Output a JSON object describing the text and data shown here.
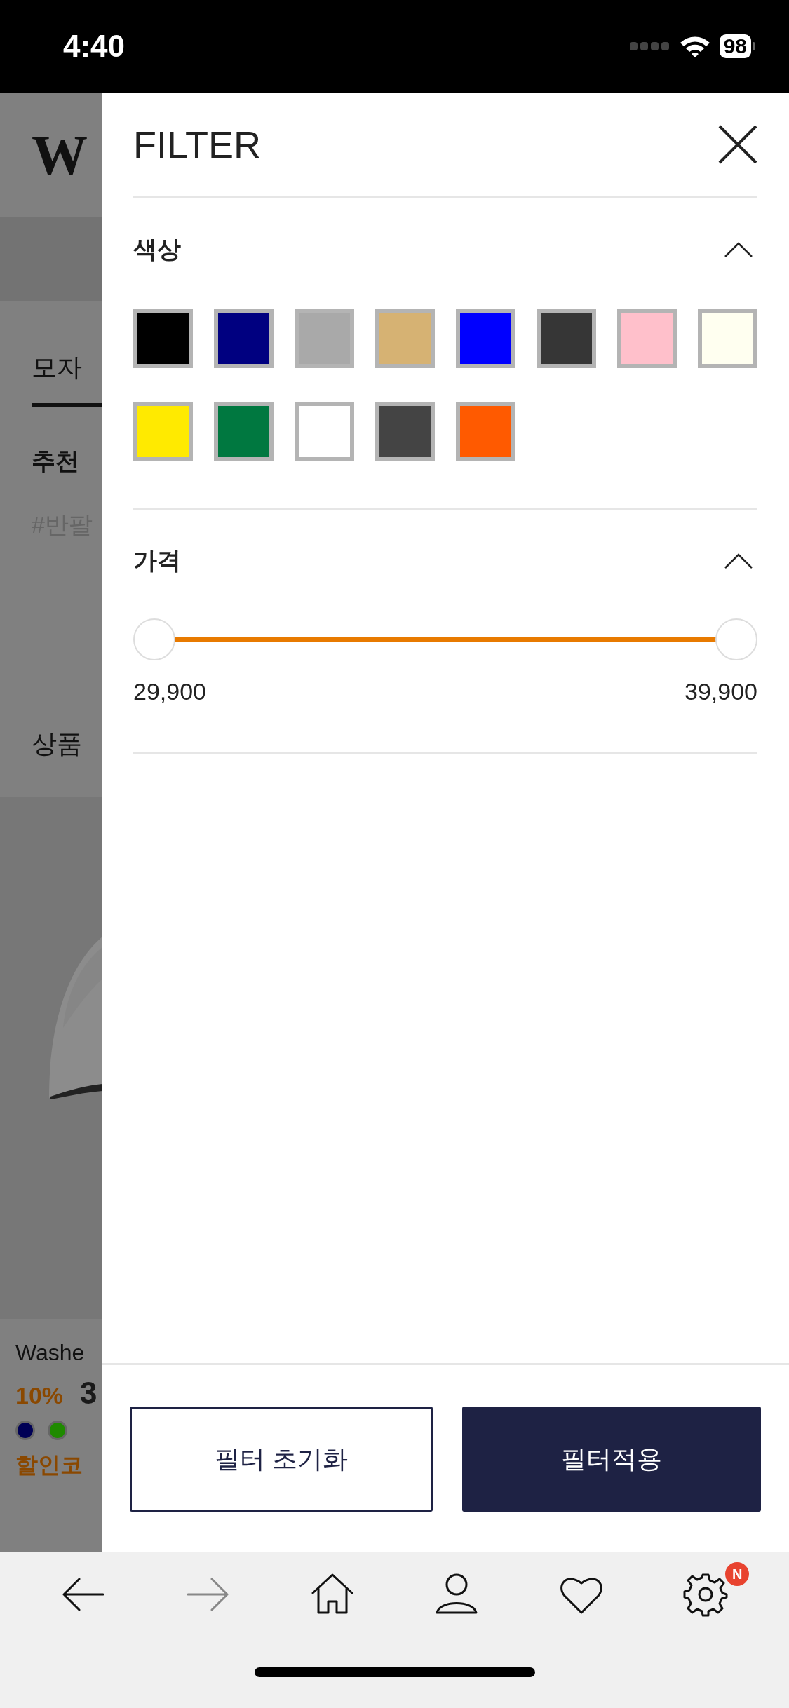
{
  "status_bar": {
    "time": "4:40",
    "battery": "98"
  },
  "background_page": {
    "logo": "W",
    "tab": "모자",
    "recommend_title": "추천",
    "hashtag": "#반팔",
    "product_info": "상품",
    "product": {
      "name": "Washe",
      "discount": "10%",
      "price": "3",
      "dots": [
        {
          "color": "#000055"
        },
        {
          "color": "#1f8a00"
        }
      ],
      "coupon": "할인코"
    }
  },
  "filter": {
    "title": "FILTER",
    "sections": [
      {
        "kind": "colors",
        "title": "색상",
        "expanded": true,
        "swatches": [
          {
            "color": "#000000"
          },
          {
            "color": "#000080"
          },
          {
            "color": "#a9a9a9"
          },
          {
            "color": "#d6b273"
          },
          {
            "color": "#0000ff"
          },
          {
            "color": "#363636"
          },
          {
            "color": "#ffc0cb"
          },
          {
            "color": "#fffff0"
          },
          {
            "color": "#ffea00"
          },
          {
            "color": "#007840"
          },
          {
            "color": "#ffffff"
          },
          {
            "color": "#444444"
          },
          {
            "color": "#ff5a00"
          }
        ]
      },
      {
        "kind": "price",
        "title": "가격",
        "expanded": true,
        "thumbs": [
          {
            "level": 0
          },
          {
            "level": 1
          }
        ],
        "min_label": "29,900",
        "max_label": "39,900"
      }
    ],
    "buttons": [
      {
        "kind": "outline",
        "label": "필터 초기화"
      },
      {
        "kind": "solid",
        "label": "필터적용"
      }
    ]
  },
  "nav": [
    {
      "kind": "back",
      "disabled": false
    },
    {
      "kind": "forward",
      "disabled": true
    },
    {
      "kind": "home",
      "disabled": false
    },
    {
      "kind": "person",
      "disabled": false
    },
    {
      "kind": "heart",
      "disabled": false
    },
    {
      "kind": "settings",
      "disabled": false,
      "badge": "N"
    }
  ]
}
